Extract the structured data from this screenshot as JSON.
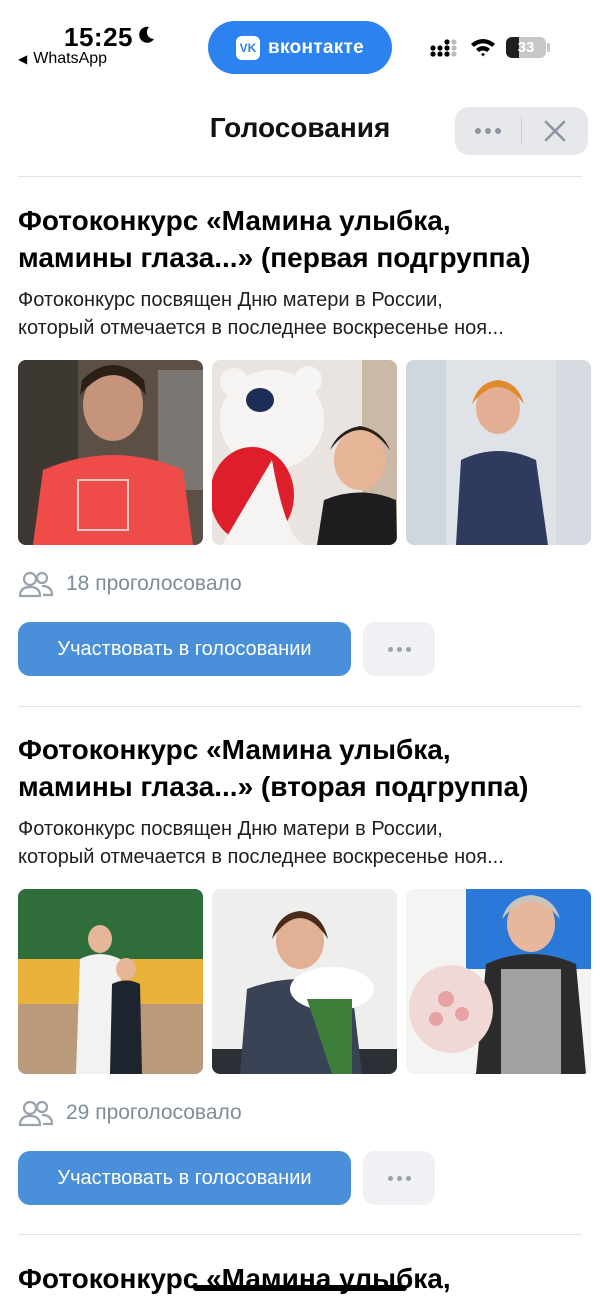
{
  "status_bar": {
    "time": "15:25",
    "back_app": "WhatsApp",
    "vk_badge": "вконтакте",
    "battery_level": "33",
    "icons": [
      "moon-icon",
      "signal-icon",
      "wifi-icon",
      "battery-icon"
    ]
  },
  "header": {
    "title": "Голосования",
    "more_icon": "ellipsis-icon",
    "close_icon": "close-icon"
  },
  "polls": [
    {
      "title_line1": "Фотоконкурс «Мамина улыбка,",
      "title_line2": "мамины глаза...» (первая подгруппа)",
      "desc_line1": "Фотоконкурс посвящен Дню матери в России,",
      "desc_line2": "который отмечается в последнее воскресенье ноя...",
      "voters": "18 проголосовало",
      "vote_button": "Участвовать в голосовании"
    },
    {
      "title_line1": "Фотоконкурс «Мамина улыбка,",
      "title_line2": "мамины глаза...» (вторая подгруппа)",
      "desc_line1": "Фотоконкурс посвящен Дню матери в России,",
      "desc_line2": "который отмечается в последнее воскресенье ноя...",
      "voters": "29 проголосовало",
      "vote_button": "Участвовать в голосовании"
    },
    {
      "title_line1": "Фотоконкурс «Мамина улыбка,"
    }
  ],
  "colors": {
    "accent": "#4a8fd9",
    "vk_blue": "#2c83f0",
    "muted": "#818c99"
  }
}
